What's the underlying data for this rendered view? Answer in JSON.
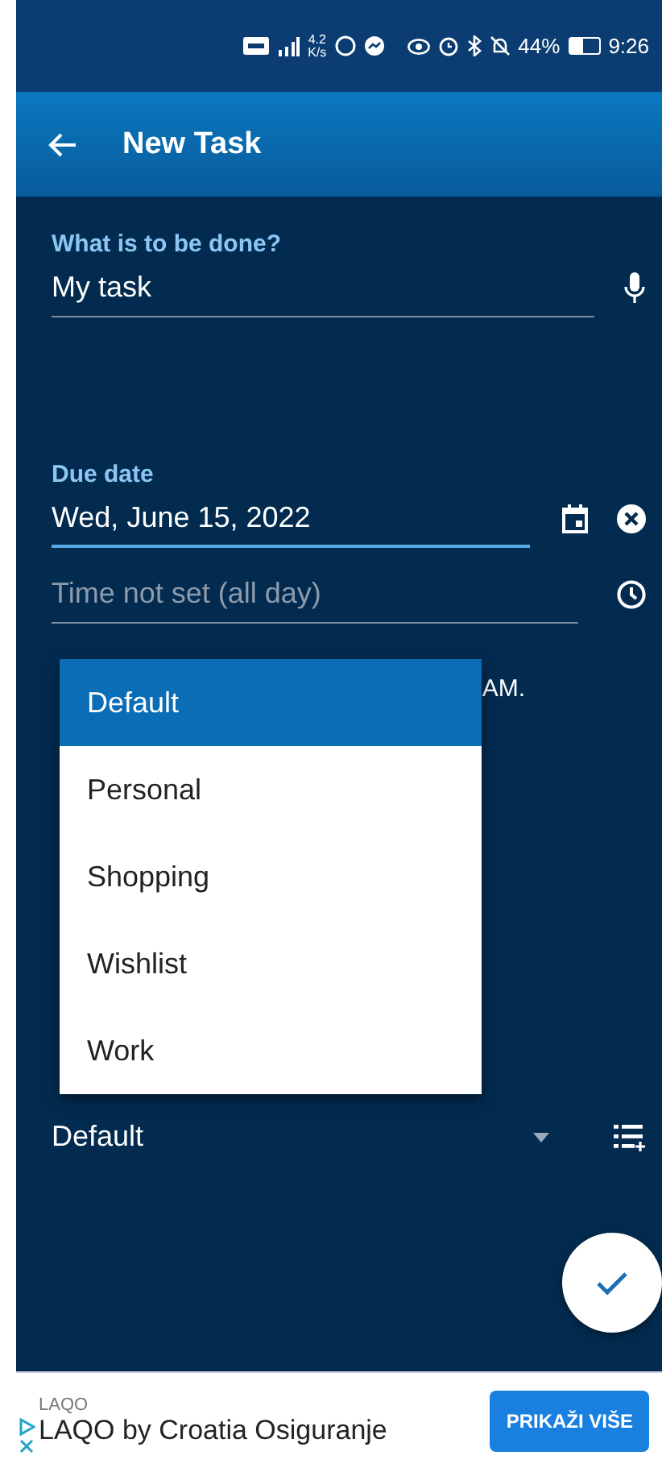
{
  "status_bar": {
    "speed": "4.2",
    "speed_unit": "K/s",
    "battery": "44%",
    "time": "9:26"
  },
  "app_bar": {
    "title": "New Task"
  },
  "task": {
    "label": "What is to be done?",
    "value": "My task"
  },
  "due": {
    "label": "Due date",
    "date": "Wed, June 15, 2022",
    "date_focused": true,
    "time_placeholder": "Time not set (all day)",
    "note_fragment": "AM."
  },
  "list": {
    "value": "Default"
  },
  "dropdown": {
    "items": [
      {
        "label": "Default",
        "selected": true
      },
      {
        "label": "Personal",
        "selected": false
      },
      {
        "label": "Shopping",
        "selected": false
      },
      {
        "label": "Wishlist",
        "selected": false
      },
      {
        "label": "Work",
        "selected": false
      }
    ]
  },
  "ad": {
    "advertiser": "LAQO",
    "title": "LAQO by Croatia Osiguranje",
    "button": "PRIKAŽI VIŠE"
  }
}
